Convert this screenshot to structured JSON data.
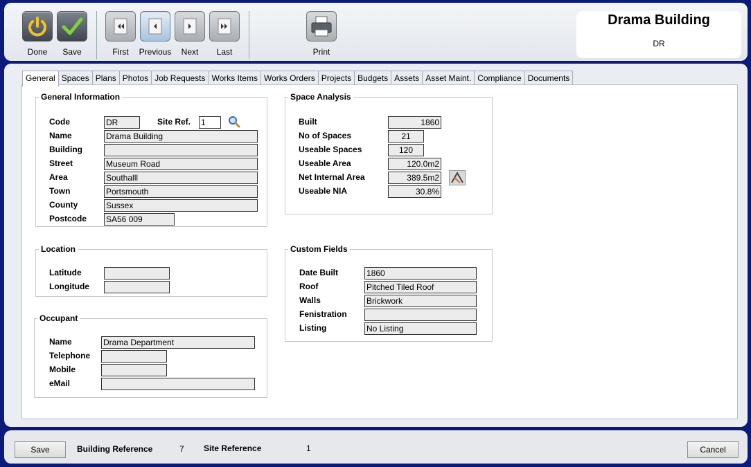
{
  "toolbar": {
    "done": "Done",
    "save": "Save",
    "first": "First",
    "previous": "Previous",
    "next": "Next",
    "last": "Last",
    "print": "Print"
  },
  "header": {
    "title": "Drama Building",
    "code": "DR"
  },
  "tabs": [
    "General",
    "Spaces",
    "Plans",
    "Photos",
    "Job Requests",
    "Works Items",
    "Works Orders",
    "Projects",
    "Budgets",
    "Assets",
    "Asset Maint.",
    "Compliance",
    "Documents"
  ],
  "general_info": {
    "legend": "General Information",
    "code_label": "Code",
    "code": "DR",
    "site_ref_label": "Site Ref.",
    "site_ref": "1",
    "name_label": "Name",
    "name": "Drama Building",
    "building_label": "Building",
    "building": "",
    "street_label": "Street",
    "street": "Museum Road",
    "area_label": "Area",
    "area": "Southalll",
    "town_label": "Town",
    "town": "Portsmouth",
    "county_label": "County",
    "county": "Sussex",
    "postcode_label": "Postcode",
    "postcode": "SA56 009"
  },
  "location": {
    "legend": "Location",
    "latitude_label": "Latitude",
    "latitude": "",
    "longitude_label": "Longitude",
    "longitude": ""
  },
  "occupant": {
    "legend": "Occupant",
    "name_label": "Name",
    "name": "Drama Department",
    "telephone_label": "Telephone",
    "telephone": "",
    "mobile_label": "Mobile",
    "mobile": "",
    "email_label": "eMail",
    "email": ""
  },
  "space_analysis": {
    "legend": "Space Analysis",
    "built_label": "Built",
    "built": "1860",
    "spaces_label": "No of Spaces",
    "spaces": "21",
    "useable_spaces_label": "Useable Spaces",
    "useable_spaces": "120",
    "useable_area_label": "Useable Area",
    "useable_area": "120.0m2",
    "nia_label": "Net Internal Area",
    "nia": "389.5m2",
    "useable_nia_label": "Useable NIA",
    "useable_nia": "30.8%"
  },
  "custom_fields": {
    "legend": "Custom Fields",
    "date_built_label": "Date Built",
    "date_built": "1860",
    "roof_label": "Roof",
    "roof": "Pitched Tiled Roof",
    "walls_label": "Walls",
    "walls": "Brickwork",
    "fenistration_label": "Fenistration",
    "fenistration": "",
    "listing_label": "Listing",
    "listing": "No Listing"
  },
  "footer": {
    "save": "Save",
    "building_ref_label": "Building Reference",
    "building_ref": "7",
    "site_ref_label": "Site Reference",
    "site_ref": "1",
    "cancel": "Cancel"
  }
}
